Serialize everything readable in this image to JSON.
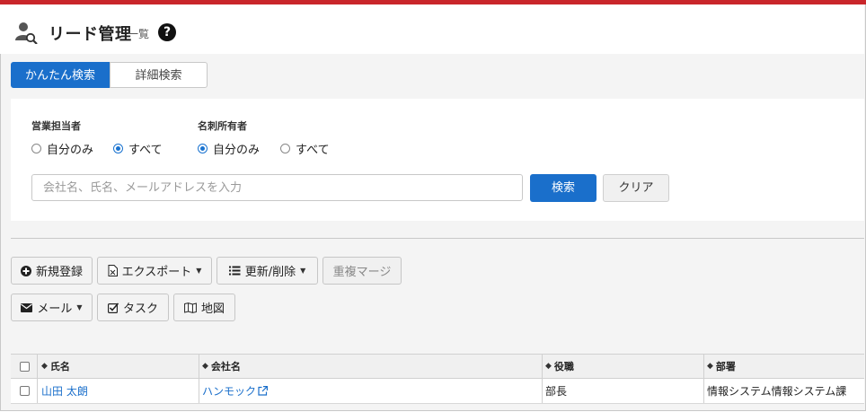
{
  "header": {
    "title": "リード管理",
    "subtitle": "一覧",
    "help": "?"
  },
  "tabs": [
    {
      "label": "かんたん検索",
      "active": true
    },
    {
      "label": "詳細検索",
      "active": false
    }
  ],
  "search": {
    "sales_owner": {
      "label": "営業担当者",
      "options": [
        "自分のみ",
        "すべて"
      ],
      "selected": "すべて"
    },
    "card_owner": {
      "label": "名刺所有者",
      "options": [
        "自分のみ",
        "すべて"
      ],
      "selected": "自分のみ"
    },
    "placeholder": "会社名、氏名、メールアドレスを入力",
    "search_button": "検索",
    "clear_button": "クリア"
  },
  "toolbar": {
    "new": "新規登録",
    "export": "エクスポート",
    "update_delete": "更新/削除",
    "merge": "重複マージ",
    "mail": "メール",
    "task": "タスク",
    "map": "地図"
  },
  "table": {
    "columns": [
      "氏名",
      "会社名",
      "役職",
      "部署"
    ],
    "rows": [
      {
        "name": "山田 太朗",
        "company": "ハンモック",
        "title": "部長",
        "department": "情報システム情報システム課"
      }
    ]
  },
  "colors": {
    "accent": "#1a6fcb",
    "topbar": "#c9262b"
  }
}
